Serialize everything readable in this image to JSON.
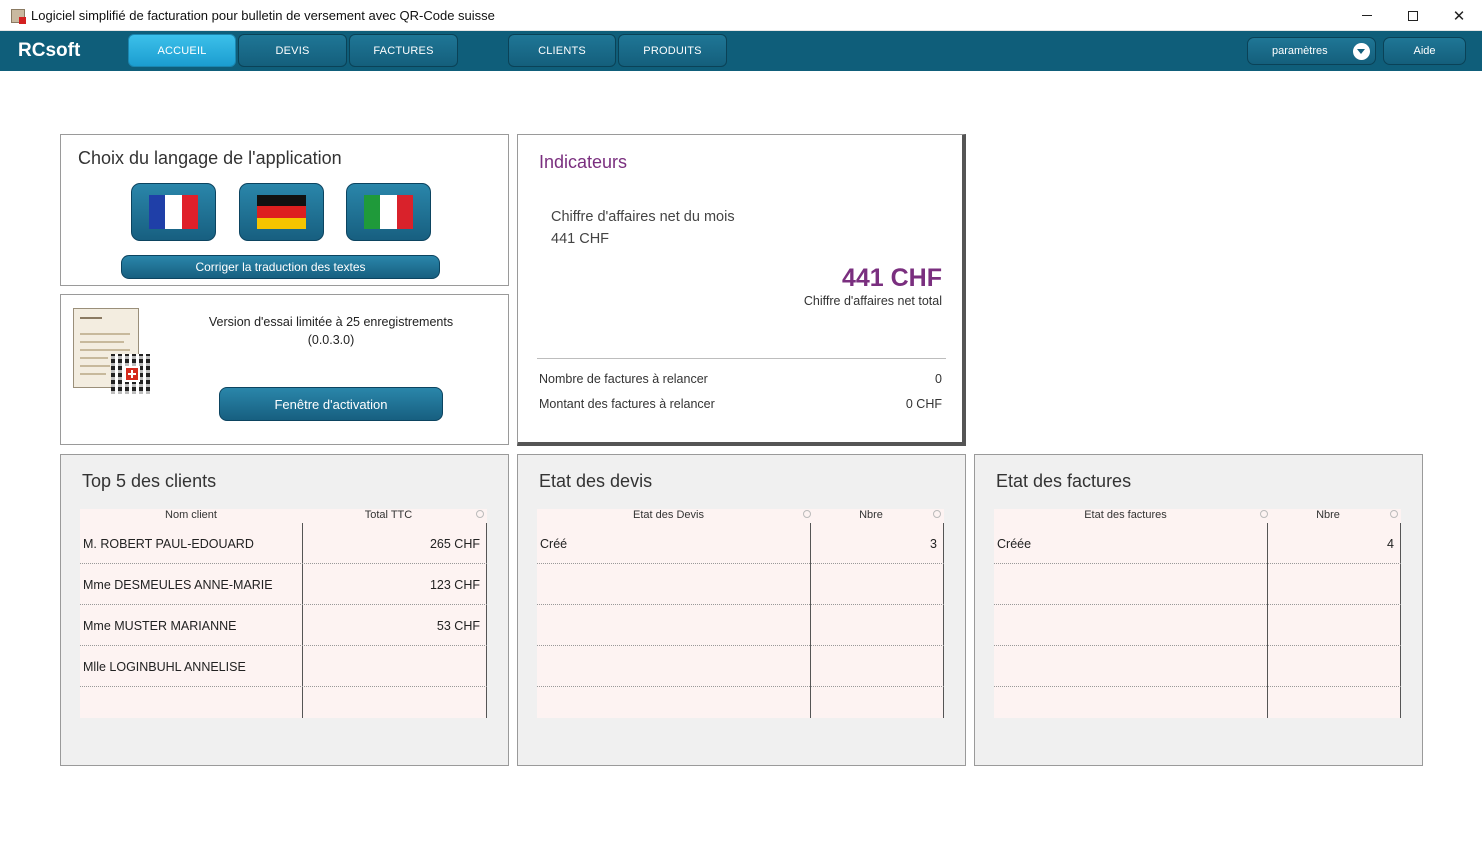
{
  "window": {
    "title": "Logiciel simplifié de facturation pour bulletin de versement avec QR-Code suisse",
    "minimize_icon": "minimize-icon",
    "maximize_icon": "maximize-icon",
    "close_glyph": "✕"
  },
  "nav": {
    "brand": "RCsoft",
    "items": [
      {
        "label": "ACCUEIL",
        "active": true
      },
      {
        "label": "DEVIS"
      },
      {
        "label": "FACTURES"
      },
      {
        "label": "CLIENTS"
      },
      {
        "label": "PRODUITS"
      }
    ],
    "params_label": "paramètres",
    "help_label": "Aide"
  },
  "language": {
    "title": "Choix du langage de l'application",
    "flags": [
      "flag-france-icon",
      "flag-germany-icon",
      "flag-italy-icon"
    ],
    "translate_button": "Corriger la traduction des textes"
  },
  "trial": {
    "line1": "Version d'essai limitée à 25 enregistrements",
    "line2": "(0.0.3.0)",
    "activation_button": "Fenêtre d'activation",
    "icon": "invoice-qr-icon"
  },
  "indicators": {
    "title": "Indicateurs",
    "month_label": "Chiffre d'affaires net du mois",
    "month_value": "441 CHF",
    "total_value": "441 CHF",
    "total_label": "Chiffre d'affaires net total",
    "reminder_count_label": "Nombre de factures à relancer",
    "reminder_count_value": "0",
    "reminder_amount_label": "Montant des factures à relancer",
    "reminder_amount_value": "0 CHF"
  },
  "top_clients": {
    "title": "Top 5 des clients",
    "col_name": "Nom client",
    "col_total": "Total TTC",
    "rows": [
      {
        "name": "M. ROBERT PAUL-EDOUARD",
        "total": "265 CHF"
      },
      {
        "name": "Mme DESMEULES ANNE-MARIE",
        "total": "123 CHF"
      },
      {
        "name": "Mme MUSTER MARIANNE",
        "total": "53 CHF"
      },
      {
        "name": "Mlle LOGINBUHL ANNELISE",
        "total": ""
      },
      {
        "name": "",
        "total": ""
      }
    ]
  },
  "quotes": {
    "title": "Etat des devis",
    "col_state": "Etat des Devis",
    "col_count": "Nbre",
    "rows": [
      {
        "state": "Créé",
        "count": "3"
      },
      {
        "state": "",
        "count": ""
      },
      {
        "state": "",
        "count": ""
      },
      {
        "state": "",
        "count": ""
      },
      {
        "state": "",
        "count": ""
      }
    ]
  },
  "invoices": {
    "title": "Etat des factures",
    "col_state": "Etat des factures",
    "col_count": "Nbre",
    "rows": [
      {
        "state": "Créée",
        "count": "4"
      },
      {
        "state": "",
        "count": ""
      },
      {
        "state": "",
        "count": ""
      },
      {
        "state": "",
        "count": ""
      },
      {
        "state": "",
        "count": ""
      }
    ]
  },
  "colors": {
    "navbar": "#0f5e7a",
    "active_tab": "#2bb0e0",
    "accent_purple": "#7a2f7f",
    "table_bg": "#fdf3f2"
  }
}
